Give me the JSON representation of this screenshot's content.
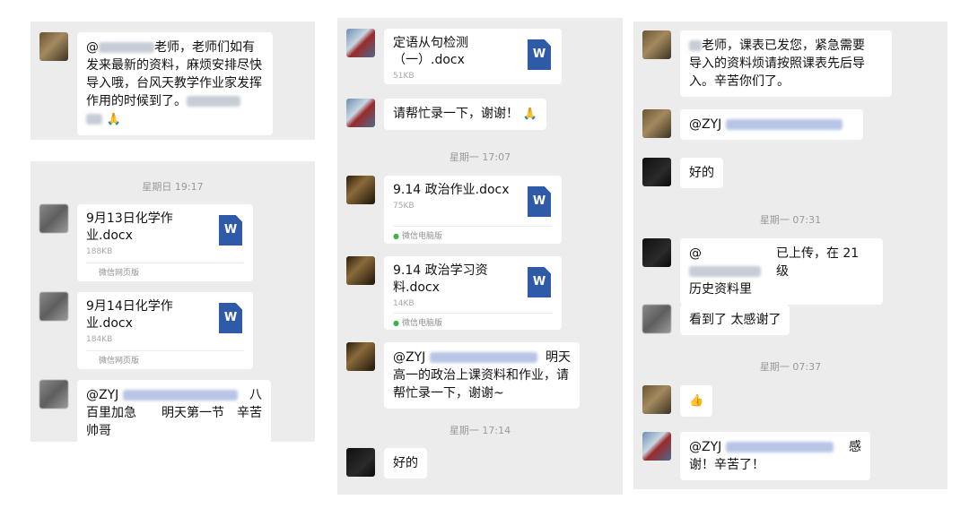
{
  "panel1": {
    "msg1": {
      "at": "@",
      "text": "老师，老师们如有发来最新的资料，麻烦安排尽快导入哦，台风天教学作业家发挥作用的时候到了。",
      "emoji": "🙏"
    }
  },
  "panel2": {
    "time1": "星期日 19:17",
    "file1": {
      "name": "9月13日化学作业.docx",
      "size": "188KB",
      "source": "微信网页版",
      "icon": "W"
    },
    "file2": {
      "name": "9月14日化学作业.docx",
      "size": "184KB",
      "source": "微信网页版",
      "icon": "W"
    },
    "msg": {
      "at": "@ZYJ",
      "tail1": "八",
      "text": "百里加急　　明天第一节　辛苦帅哥"
    }
  },
  "panel3": {
    "file1": {
      "name": "定语从句检测（一）.docx",
      "size": "51KB",
      "icon": "W"
    },
    "msg1": {
      "text": "请帮忙录一下，谢谢！",
      "emoji": "🙏"
    },
    "time1": "星期一 17:07",
    "file2": {
      "name": "9.14 政治作业.docx",
      "size": "75KB",
      "source": "微信电脑版",
      "icon": "W"
    },
    "file3": {
      "name": "9.14 政治学习资料.docx",
      "size": "14KB",
      "source": "微信电脑版",
      "icon": "W"
    },
    "msg2": {
      "at": "@ZYJ",
      "tail1": "明天",
      "text": "高一的政治上课资料和作业，请帮忙录一下，谢谢~"
    },
    "time2": "星期一 17:14",
    "msg3": "好的"
  },
  "panel4": {
    "msg1": {
      "text1": "老师，课表已发您，紧急需要",
      "text2": "导入的资料烦请按照课表先后导入。辛苦你们了。"
    },
    "msg2": {
      "at": "@ZYJ"
    },
    "msg3": "好的",
    "time1": "星期一 07:31",
    "msg4": {
      "at": "@",
      "tail1": "已上传，在 21 级",
      "text2": "历史资料里"
    },
    "msg5": "看到了 太感谢了",
    "time2": "星期一 07:37",
    "msg6": {
      "emoji": "👍"
    },
    "msg7": {
      "at": "@ZYJ",
      "tail1": "感",
      "text2": "谢！辛苦了！"
    }
  }
}
